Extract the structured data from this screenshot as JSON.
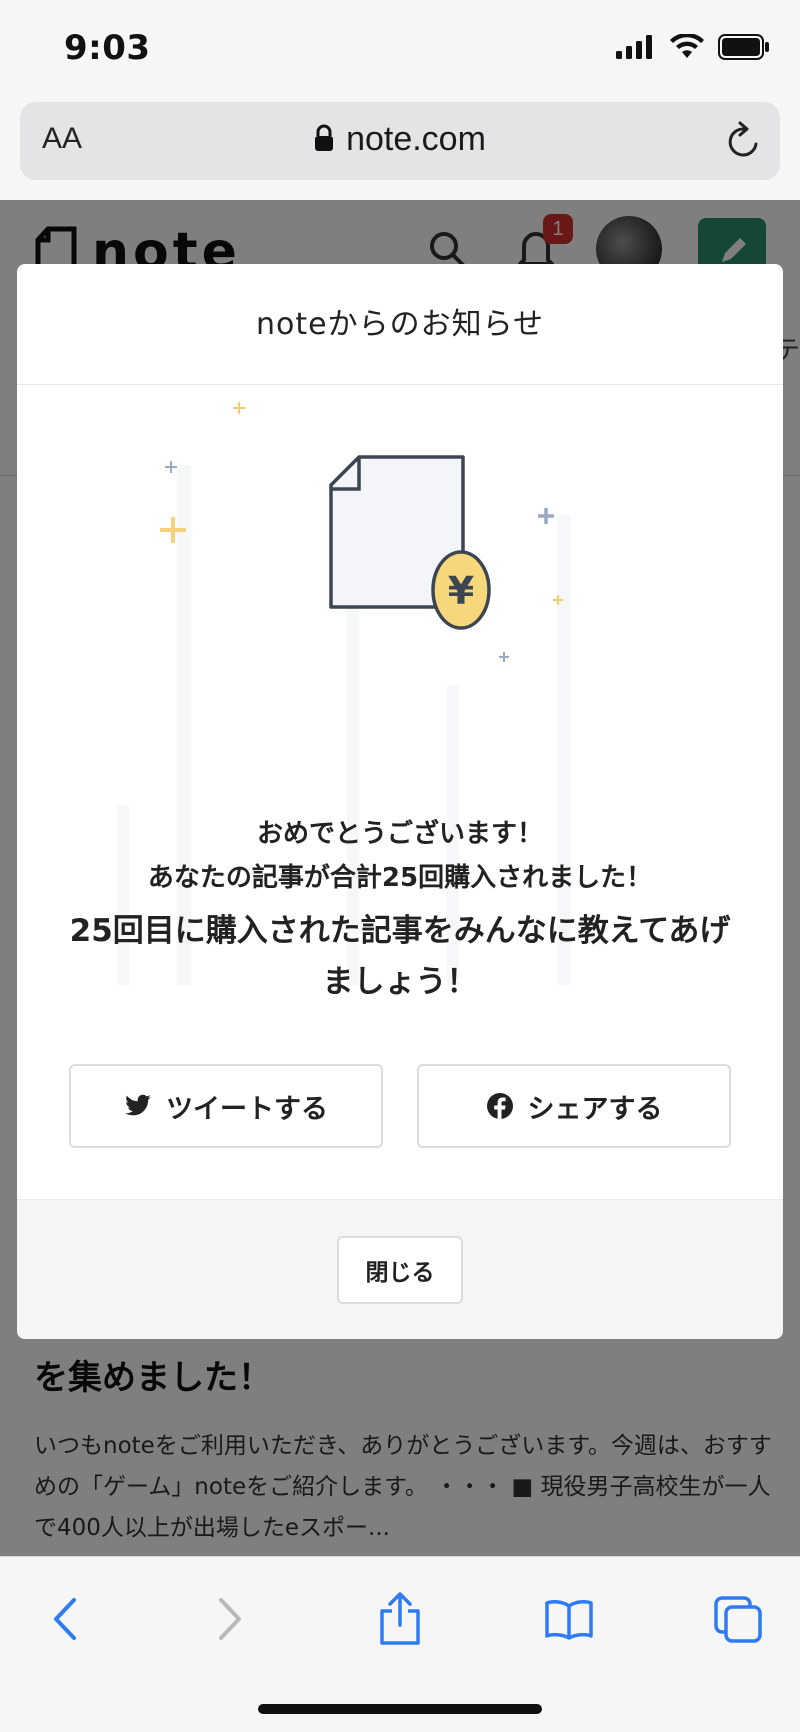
{
  "status_bar": {
    "time": "9:03"
  },
  "browser": {
    "text_size_label": "AA",
    "url": "note.com"
  },
  "page": {
    "logo_text": "note",
    "notification_count": "1",
    "subnav_edge_text": "テ",
    "article_title": "を集めました！",
    "article_excerpt": "いつもnoteをご利用いただき、ありがとうございます。今週は、おすすめの「ゲーム」noteをご紹介します。 ・・・ ■ 現役男子高校生が一人で400人以上が出場したeスポー..."
  },
  "modal": {
    "title": "noteからのお知らせ",
    "coin_symbol": "¥",
    "message_line1": "おめでとうございます！",
    "message_line2": "あなたの記事が合計25回購入されました！",
    "message_line3": "25回目に購入された記事をみんなに教えてあげましょう！",
    "tweet_label": "ツイートする",
    "share_label": "シェアする",
    "close_label": "閉じる"
  },
  "colors": {
    "brand_green": "#2a8f6d",
    "coin_yellow": "#f7d77c",
    "badge_red": "#d32f2f"
  }
}
